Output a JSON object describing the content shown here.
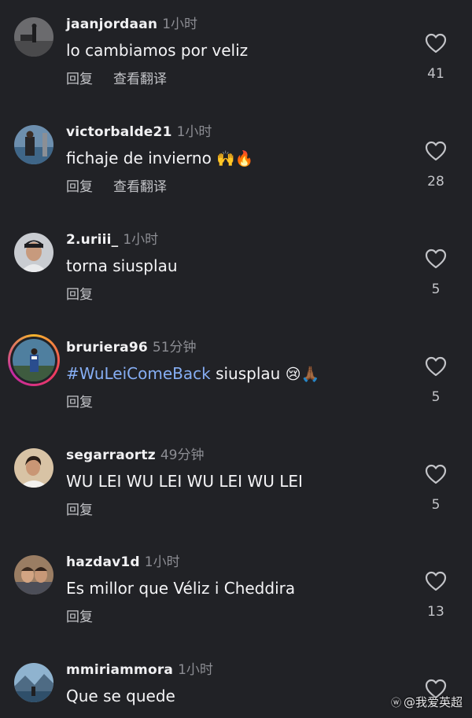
{
  "actions": {
    "reply_label": "回复",
    "translate_label": "查看翻译"
  },
  "icons": {
    "like": "heart-outline-icon"
  },
  "colors": {
    "background": "#212226",
    "hashtag": "#86aef4",
    "meta": "#8c8d93"
  },
  "comments": [
    {
      "username": "jaanjordaan",
      "time": "1小时",
      "text": "lo cambiamos por veliz",
      "likes": "41",
      "has_translate": true
    },
    {
      "username": "victorbalde21",
      "time": "1小时",
      "text": "fichaje de invierno",
      "emoji": "🙌🔥",
      "likes": "28",
      "has_translate": true
    },
    {
      "username": "2.uriii_",
      "time": "1小时",
      "text": "torna siusplau",
      "likes": "5",
      "has_translate": false
    },
    {
      "username": "bruriera96",
      "time": "51分钟",
      "hashtag": "#WuLeiComeBack",
      "text": "siusplau",
      "emoji": "😢🙏🏾",
      "likes": "5",
      "has_translate": false,
      "story_ring": true
    },
    {
      "username": "segarraortz",
      "time": "49分钟",
      "text": "WU LEI WU LEI WU LEI WU LEI",
      "likes": "5",
      "has_translate": false
    },
    {
      "username": "hazdav1d",
      "time": "1小时",
      "text": "Es millor que Véliz i Cheddira",
      "likes": "13",
      "has_translate": false
    },
    {
      "username": "mmiriammora",
      "time": "1小时",
      "text": "Que se quede",
      "likes": "",
      "has_translate": false
    }
  ],
  "watermark": {
    "logo": "ⓦ",
    "text": "@我爱英超"
  }
}
